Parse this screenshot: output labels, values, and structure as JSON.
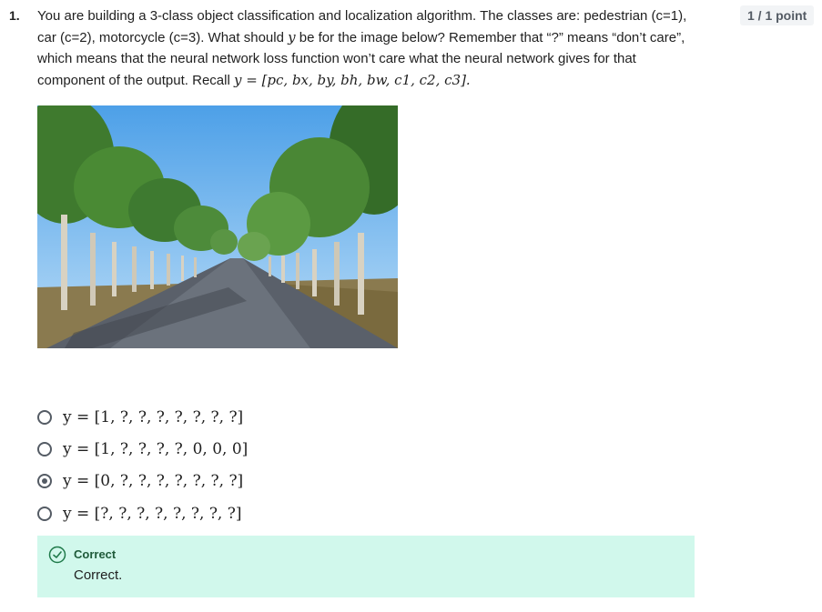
{
  "question": {
    "number": "1.",
    "text_line1": "You are building a 3-class object classification and localization algorithm. The classes are: pedestrian (c=1),",
    "text_line2": "car (c=2), motorcycle (c=3). What should ",
    "text_line2_var": "y",
    "text_line2_end": " be for the image below? Remember that “?” means “don’t care”,",
    "text_line3": "which means that the neural network loss function won’t care what the neural network gives for that",
    "text_line4": "component of the output. Recall ",
    "recall_formula": "y = [pc, bx, by, bh, bw, c1, c2, c3].",
    "points": "1 / 1 point"
  },
  "options": [
    {
      "label": "y = [1, ?, ?, ?, ?, ?, ?, ?]",
      "selected": false
    },
    {
      "label": "y = [1, ?, ?, ?, ?, 0, 0, 0]",
      "selected": false
    },
    {
      "label": "y = [0, ?, ?, ?, ?, ?, ?, ?]",
      "selected": true
    },
    {
      "label": "y = [?, ?, ?, ?, ?, ?, ?, ?]",
      "selected": false
    }
  ],
  "feedback": {
    "title": "Correct",
    "text": "Correct.",
    "icon": "check-circle-icon",
    "background": "#d1f8ec"
  },
  "image": {
    "subject": "tree-lined road"
  }
}
